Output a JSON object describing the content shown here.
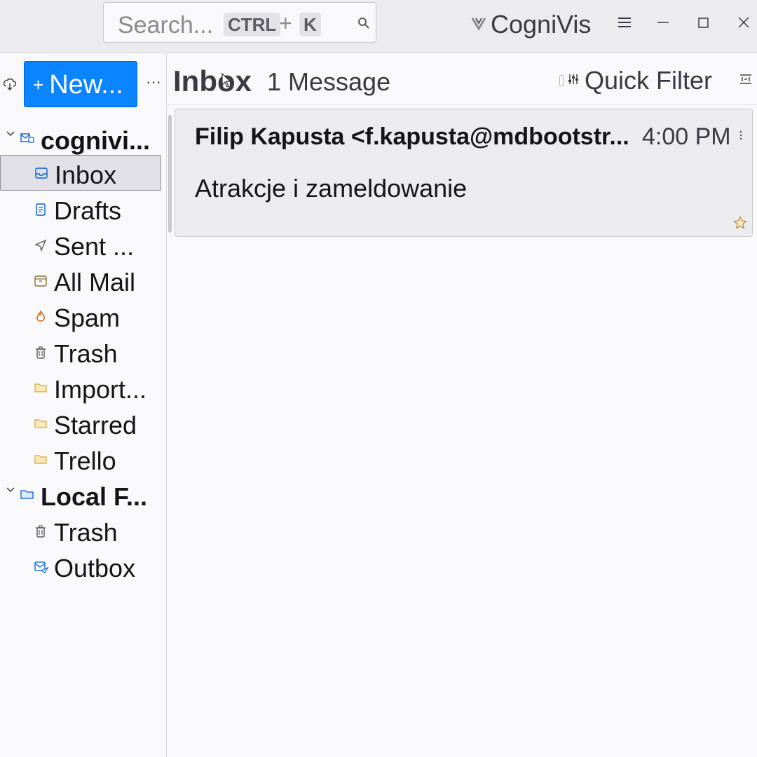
{
  "titlebar": {
    "search": {
      "placeholder": "Search...",
      "shortcut_ctrl": "CTRL",
      "shortcut_plus": "+",
      "shortcut_key": "K"
    },
    "app_name": "CogniVis"
  },
  "sidebar": {
    "new_button": {
      "plus": "+",
      "label": "New..."
    },
    "more": "···",
    "accounts": [
      {
        "name": "cognivi...",
        "folders": [
          {
            "label": "Inbox",
            "icon": "inbox-icon",
            "selected": true
          },
          {
            "label": "Drafts",
            "icon": "drafts-icon"
          },
          {
            "label": "Sent ...",
            "icon": "sent-icon"
          },
          {
            "label": "All Mail",
            "icon": "archive-icon"
          },
          {
            "label": "Spam",
            "icon": "spam-icon"
          },
          {
            "label": "Trash",
            "icon": "trash-icon"
          },
          {
            "label": "Import...",
            "icon": "folder-icon"
          },
          {
            "label": "Starred",
            "icon": "folder-icon"
          },
          {
            "label": "Trello",
            "icon": "folder-icon"
          }
        ]
      },
      {
        "name": "Local F...",
        "folders": [
          {
            "label": "Trash",
            "icon": "trash-icon"
          },
          {
            "label": "Outbox",
            "icon": "outbox-icon"
          }
        ]
      }
    ]
  },
  "toolbar": {
    "folder_title": "Inbox",
    "message_count": "1 Message",
    "quick_filter": "Quick Filter"
  },
  "messages": [
    {
      "sender": "Filip Kapusta <f.kapusta@mdbootstr...",
      "time": "4:00 PM",
      "subject": "Atrakcje i zameldowanie",
      "starred": false
    }
  ],
  "colors": {
    "accent": "#0a84ff",
    "folder": "#f1c97b",
    "selected_bg": "#e0e0e6"
  }
}
